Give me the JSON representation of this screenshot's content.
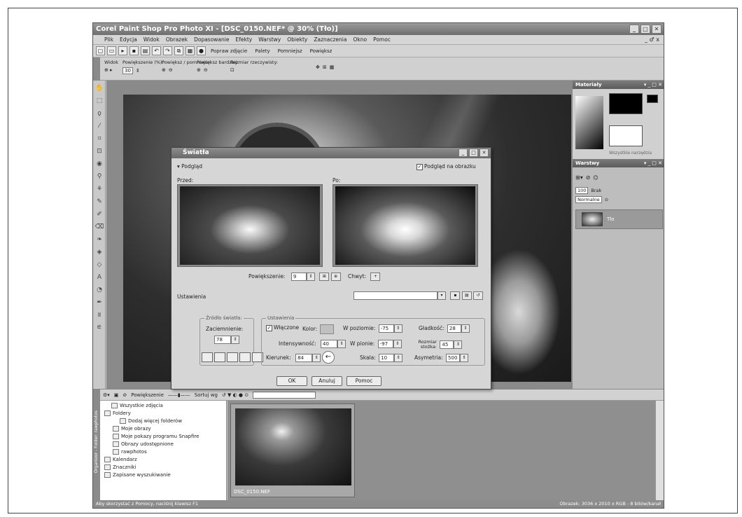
{
  "window": {
    "title": "Corel Paint Shop Pro Photo XI - [DSC_0150.NEF* @ 30% (Tło)]",
    "controls": [
      "_",
      "□",
      "✕"
    ]
  },
  "menu": {
    "items": [
      "Plik",
      "Edycja",
      "Widok",
      "Obrazek",
      "Dopasowanie",
      "Efekty",
      "Warstwy",
      "Obiekty",
      "Zaznaczenia",
      "Okno",
      "Pomoc"
    ],
    "right_controls": "_ ♂ x"
  },
  "toolbar": {
    "popraw": "Popraw zdjęcie",
    "palety": "Palety",
    "pomniejsz": "Pomniejsz",
    "powieksz": "Powiększ"
  },
  "options": {
    "widok": "Widok",
    "powiekszenie": "Powiększenie (%):",
    "powiekszenie_value": "30",
    "powieksz_pomniejsz": "Powiększ / pomniejsz:",
    "powieksz_bardziej": "Powiększ bardziej:",
    "rozmiar": "Rozmiar rzeczywisty:"
  },
  "materials": {
    "title": "Materiały",
    "note": "Wszystkie narzędzia"
  },
  "layers": {
    "title": "Warstwy",
    "opacity": "100",
    "blend": "Normalne",
    "none_label": "Brak",
    "layer_name": "Tło"
  },
  "dialog": {
    "title": "Światła",
    "podglad": "Podgląd",
    "podglad_na_obrazku": "Podgląd na obrazku",
    "przed": "Przed:",
    "po": "Po:",
    "powiekszenie_label": "Powiększenie:",
    "powiekszenie_value": "9",
    "chwyt": "Chwyt:",
    "ustawienia": "Ustawienia",
    "zrodlo_title": "Źródło światła:",
    "zaciemnienie": "Zaciemnienie:",
    "zaciemnienie_value": "78",
    "ustawienia_group": "Ustawienia",
    "wlaczone": "Włączone",
    "kolor": "Kolor:",
    "intensywnosc": "Intensywność:",
    "intensywnosc_value": "40",
    "kierunek": "Kierunek:",
    "kierunek_value": "84",
    "w_poziomie": "W poziomie:",
    "w_poziomie_value": "-75",
    "w_pionie": "W pionie:",
    "w_pionie_value": "-97",
    "skala": "Skala:",
    "skala_value": "10",
    "gladkosc": "Gładkość:",
    "gladkosc_value": "28",
    "rozmiar_stozka": "Rozmiar stożka:",
    "rozmiar_stozka_value": "45",
    "asymetria": "Asymetria:",
    "asymetria_value": "500",
    "ok": "OK",
    "anuluj": "Anuluj",
    "pomoc": "Pomoc"
  },
  "organizer": {
    "vertical_label": "Organizer - Folder: rawphotos",
    "powiekszenie": "Powiększenie",
    "sortuj": "Sortuj wg",
    "tree": [
      {
        "label": "Wszystkie zdjęcia",
        "indent": 1
      },
      {
        "label": "Foldery",
        "indent": 0
      },
      {
        "label": "Dodaj więcej folderów",
        "indent": 3
      },
      {
        "label": "Moje obrazy",
        "indent": 2
      },
      {
        "label": "Moje pokazy programu Snapfire",
        "indent": 2
      },
      {
        "label": "Obrazy udostępnione",
        "indent": 2
      },
      {
        "label": "rawphotos",
        "indent": 2
      },
      {
        "label": "Kalendarz",
        "indent": 0
      },
      {
        "label": "Znaczniki",
        "indent": 0
      },
      {
        "label": "Zapisane wyszukiwanie",
        "indent": 0
      }
    ],
    "thumb_label": "DSC_0150.NEF"
  },
  "status": {
    "left": "Aby skorzystać z Pomocy, naciśnij klawisz F1",
    "right": "Obrazek: 3036 x 2010 x RGB - 8 bitów/kanał"
  }
}
